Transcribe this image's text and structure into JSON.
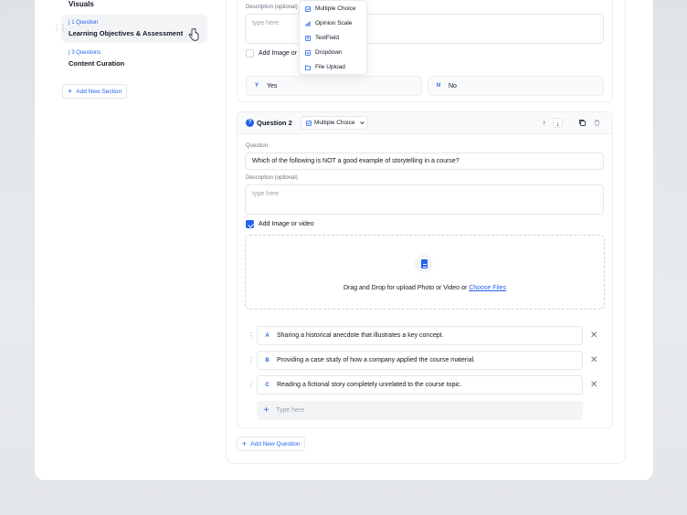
{
  "sidebar": {
    "visuals_label": "Visuals",
    "items": [
      {
        "count": "1 Question",
        "title": "Learning Objectives & Assessment"
      },
      {
        "count": "3 Questions",
        "title": "Content Curation"
      }
    ],
    "add_section_label": "Add New Section"
  },
  "question1": {
    "description_label": "Description (optional)",
    "description_placeholder": "type here",
    "add_media_label": "Add Image or video",
    "add_media_checked": false,
    "answers": [
      {
        "key": "Y",
        "text": "Yes"
      },
      {
        "key": "N",
        "text": "No"
      }
    ]
  },
  "type_menu": {
    "items": [
      {
        "label": "Multiple Choice",
        "icon": "checkbox-icon"
      },
      {
        "label": "Opinion Scale",
        "icon": "bar-chart-icon"
      },
      {
        "label": "TextField",
        "icon": "text-field-icon"
      },
      {
        "label": "Dropdown",
        "icon": "dropdown-icon"
      },
      {
        "label": "File Upload",
        "icon": "folder-icon"
      }
    ]
  },
  "question2": {
    "badge": "?",
    "title": "Question 2",
    "type": "Multiple Choice",
    "question_label": "Question",
    "question_text": "Which of the following is NOT a good example of storytelling in a course?",
    "description_label": "Description (optional)",
    "description_placeholder": "type here",
    "add_media_label": "Add Image or video",
    "add_media_checked": true,
    "upload_text": "Drag and Drop for upload Photo or Video or",
    "upload_link": "Choose Files",
    "options": [
      {
        "key": "A",
        "text": "Sharing a historical anecdote that illustrates a key concept."
      },
      {
        "key": "B",
        "text": "Providing a case study of how a company applied the course material."
      },
      {
        "key": "C",
        "text": "Reading a fictional story completely unrelated to the course topic."
      }
    ],
    "add_option_placeholder": "Type here"
  },
  "add_question_label": "Add New Question",
  "colors": {
    "accent": "#2563eb",
    "background": "#e3e6ea",
    "panel": "#ffffff"
  }
}
